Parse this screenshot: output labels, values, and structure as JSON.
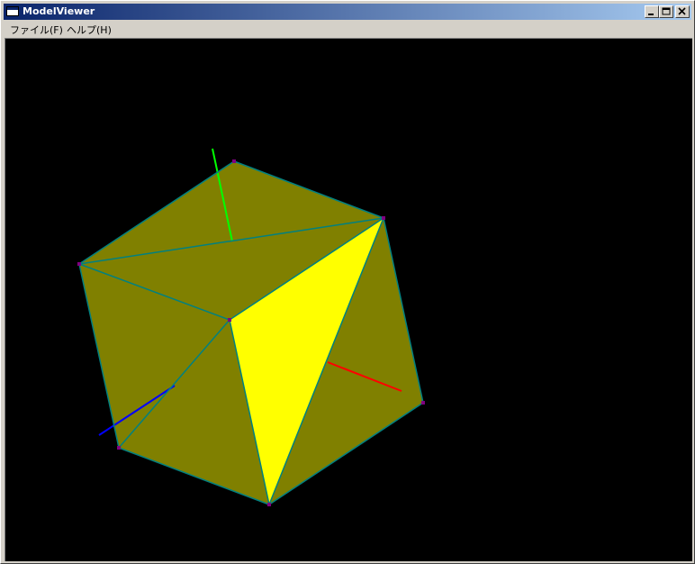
{
  "window": {
    "title": "ModelViewer"
  },
  "menu": {
    "items": [
      {
        "label": "ファイル(F)"
      },
      {
        "label": "ヘルプ(H)"
      }
    ]
  },
  "viewport": {
    "background": "#000000",
    "face_color": "#808000",
    "highlight_face_color": "#ffff00",
    "edge_color": "#008080",
    "vertex_color": "#800080",
    "axis_colors": {
      "x": "#ff0000",
      "y": "#00ff00",
      "z": "#0000ff"
    }
  }
}
